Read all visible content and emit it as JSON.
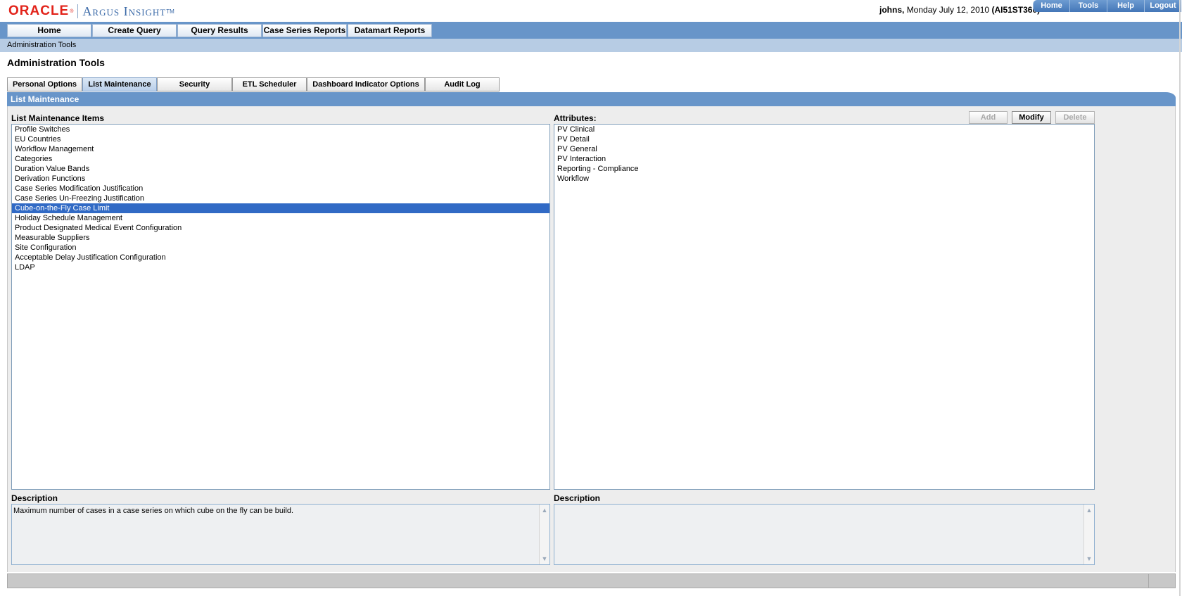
{
  "header": {
    "logo_oracle": "ORACLE",
    "logo_reg": "®",
    "logo_product": "Argus Insight",
    "logo_tm": "TM",
    "user": "johns,",
    "date": "Monday July 12, 2010",
    "environment": "(AI51ST360)",
    "util_nav": [
      "Home",
      "Tools",
      "Help",
      "Logout"
    ]
  },
  "main_nav": [
    "Home",
    "Create Query",
    "Query Results",
    "Case Series Reports",
    "Datamart Reports"
  ],
  "breadcrumb": "Administration Tools",
  "page_title": "Administration Tools",
  "tabs": [
    "Personal Options",
    "List Maintenance",
    "Security",
    "ETL Scheduler",
    "Dashboard Indicator Options",
    "Audit Log"
  ],
  "active_tab": "List Maintenance",
  "panel_title": "List Maintenance",
  "list_section": {
    "label": "List Maintenance Items",
    "items": [
      "Profile Switches",
      "EU Countries",
      "Workflow Management",
      "Categories",
      "Duration Value Bands",
      "Derivation Functions",
      "Case Series Modification Justification",
      "Case Series Un-Freezing Justification",
      "Cube-on-the-Fly Case Limit",
      "Holiday Schedule Management",
      "Product Designated Medical Event Configuration",
      "Measurable Suppliers",
      "Site Configuration",
      "Acceptable Delay Justification Configuration",
      "LDAP"
    ],
    "selected_index": 8
  },
  "attributes_section": {
    "label": "Attributes:",
    "items": [
      "PV Clinical",
      "PV Detail",
      "PV General",
      "PV Interaction",
      "Reporting - Compliance",
      "Workflow"
    ],
    "buttons": {
      "add": "Add",
      "modify": "Modify",
      "delete": "Delete"
    }
  },
  "description_left": {
    "label": "Description",
    "text": "Maximum number of cases in a case series on which cube on the fly can be build."
  },
  "description_right": {
    "label": "Description",
    "text": ""
  },
  "colors": {
    "nav_blue": "#6895c9",
    "subbar_blue": "#b7cce4",
    "selection": "#316ac5",
    "oracle_red": "#e2231a"
  }
}
